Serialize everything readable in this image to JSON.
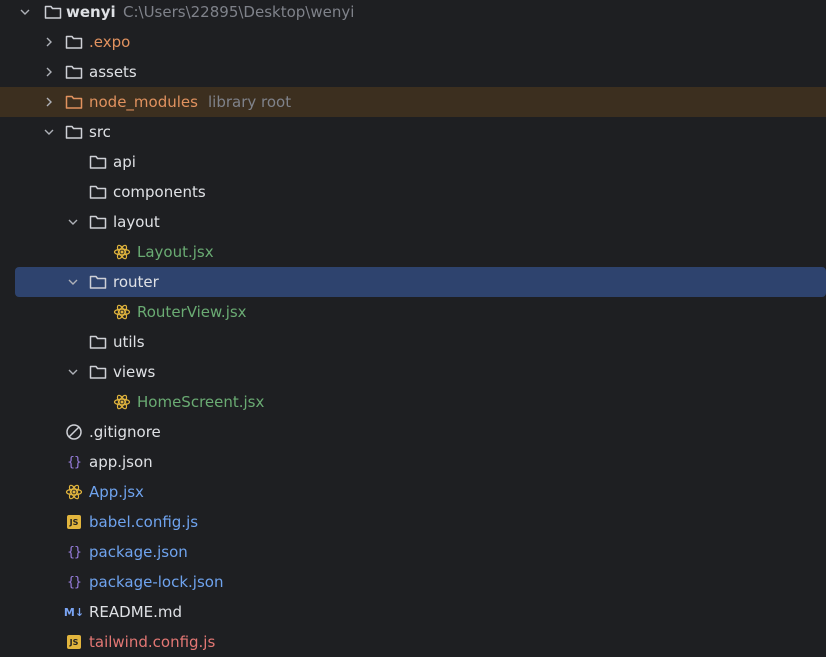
{
  "project": {
    "name": "wenyi",
    "path": "C:\\Users\\22895\\Desktop\\wenyi"
  },
  "items": [
    {
      "label": ".expo",
      "icon": "folder-icon",
      "color": "#e1925f"
    },
    {
      "label": "assets",
      "icon": "folder-icon"
    },
    {
      "label": "node_modules",
      "hint": "library root",
      "icon": "folder-icon",
      "color": "#e1925f"
    },
    {
      "label": "src",
      "icon": "folder-icon"
    },
    {
      "label": "api",
      "icon": "folder-icon"
    },
    {
      "label": "components",
      "icon": "folder-icon"
    },
    {
      "label": "layout",
      "icon": "folder-icon"
    },
    {
      "label": "Layout.jsx",
      "icon": "react-icon",
      "color": "#6aab73"
    },
    {
      "label": "router",
      "icon": "folder-icon",
      "selected": true
    },
    {
      "label": "RouterView.jsx",
      "icon": "react-icon",
      "color": "#6aab73"
    },
    {
      "label": "utils",
      "icon": "folder-icon"
    },
    {
      "label": "views",
      "icon": "folder-icon"
    },
    {
      "label": "HomeScreent.jsx",
      "icon": "react-icon",
      "color": "#6aab73"
    },
    {
      "label": ".gitignore",
      "icon": "ignore-icon"
    },
    {
      "label": "app.json",
      "icon": "json-icon"
    },
    {
      "label": "App.jsx",
      "icon": "react-icon",
      "color": "#6fa3ee"
    },
    {
      "label": "babel.config.js",
      "icon": "js-icon",
      "color": "#6fa3ee"
    },
    {
      "label": "package.json",
      "icon": "json-icon",
      "color": "#6fa3ee"
    },
    {
      "label": "package-lock.json",
      "icon": "json-icon",
      "color": "#6fa3ee"
    },
    {
      "label": "README.md",
      "icon": "markdown-icon"
    },
    {
      "label": "tailwind.config.js",
      "icon": "js-icon",
      "color": "#e37774"
    }
  ],
  "icons": {
    "json_glyph": "{}",
    "js_glyph": "JS",
    "md_glyph": "M↓"
  }
}
